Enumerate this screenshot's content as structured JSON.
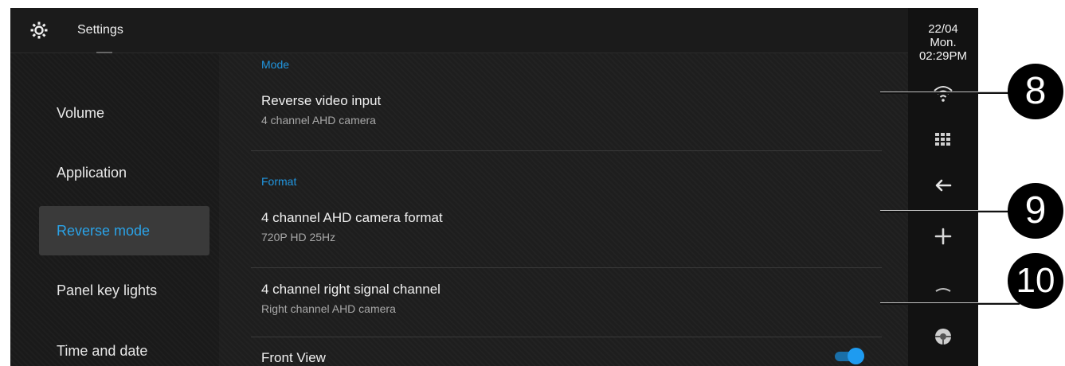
{
  "header": {
    "title": "Settings",
    "icon": "gear-icon"
  },
  "sidebar": {
    "items": [
      {
        "label": "Volume",
        "active": false
      },
      {
        "label": "Application",
        "active": false
      },
      {
        "label": "Reverse mode",
        "active": true
      },
      {
        "label": "Panel key lights",
        "active": false
      },
      {
        "label": "Time and date",
        "active": false
      }
    ]
  },
  "main": {
    "sections": [
      {
        "heading": "Mode"
      },
      {
        "heading": "Format"
      }
    ],
    "rows": [
      {
        "title": "Reverse video input",
        "subtitle": "4 channel AHD camera"
      },
      {
        "title": "4 channel AHD camera format",
        "subtitle": "720P HD 25Hz"
      },
      {
        "title": "4 channel right signal channel",
        "subtitle": "Right channel AHD camera"
      },
      {
        "title": "Front View",
        "toggle_on": true
      }
    ]
  },
  "status_bar": {
    "date": "22/04",
    "day": "Mon.",
    "time": "02:29PM",
    "icons": [
      "wifi-icon",
      "apps-grid-icon",
      "back-arrow-icon",
      "fan-icon",
      "brightness-icon",
      "steering-wheel-icon"
    ]
  },
  "callouts": [
    "8",
    "9",
    "10"
  ],
  "colors": {
    "accent": "#2196e0",
    "background": "#1e1e1e",
    "active_item_bg": "#3a3a3a"
  }
}
